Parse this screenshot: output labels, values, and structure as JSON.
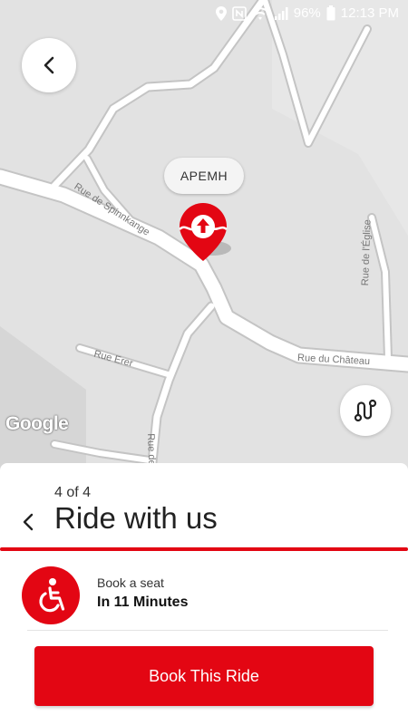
{
  "status_bar": {
    "battery": "96%",
    "time": "12:13 PM",
    "icons": [
      "location-icon",
      "nfc-icon",
      "wifi-icon",
      "signal-icon",
      "battery-icon"
    ]
  },
  "map": {
    "pin_label": "APEMH",
    "google_logo": "Google",
    "road_labels": [
      "Rue de Spinnkange",
      "Rue du Château",
      "Rue de l'Église",
      "Rue Erer",
      "Rue de"
    ]
  },
  "sheet": {
    "step": "4 of 4",
    "title": "Ride with us",
    "option": {
      "label": "Book a seat",
      "time": "In 11 Minutes",
      "icon": "wheelchair-icon"
    },
    "button": "Book This Ride"
  },
  "colors": {
    "accent": "#e30613",
    "map_bg": "#e2e2e2",
    "road": "#ffffff"
  }
}
